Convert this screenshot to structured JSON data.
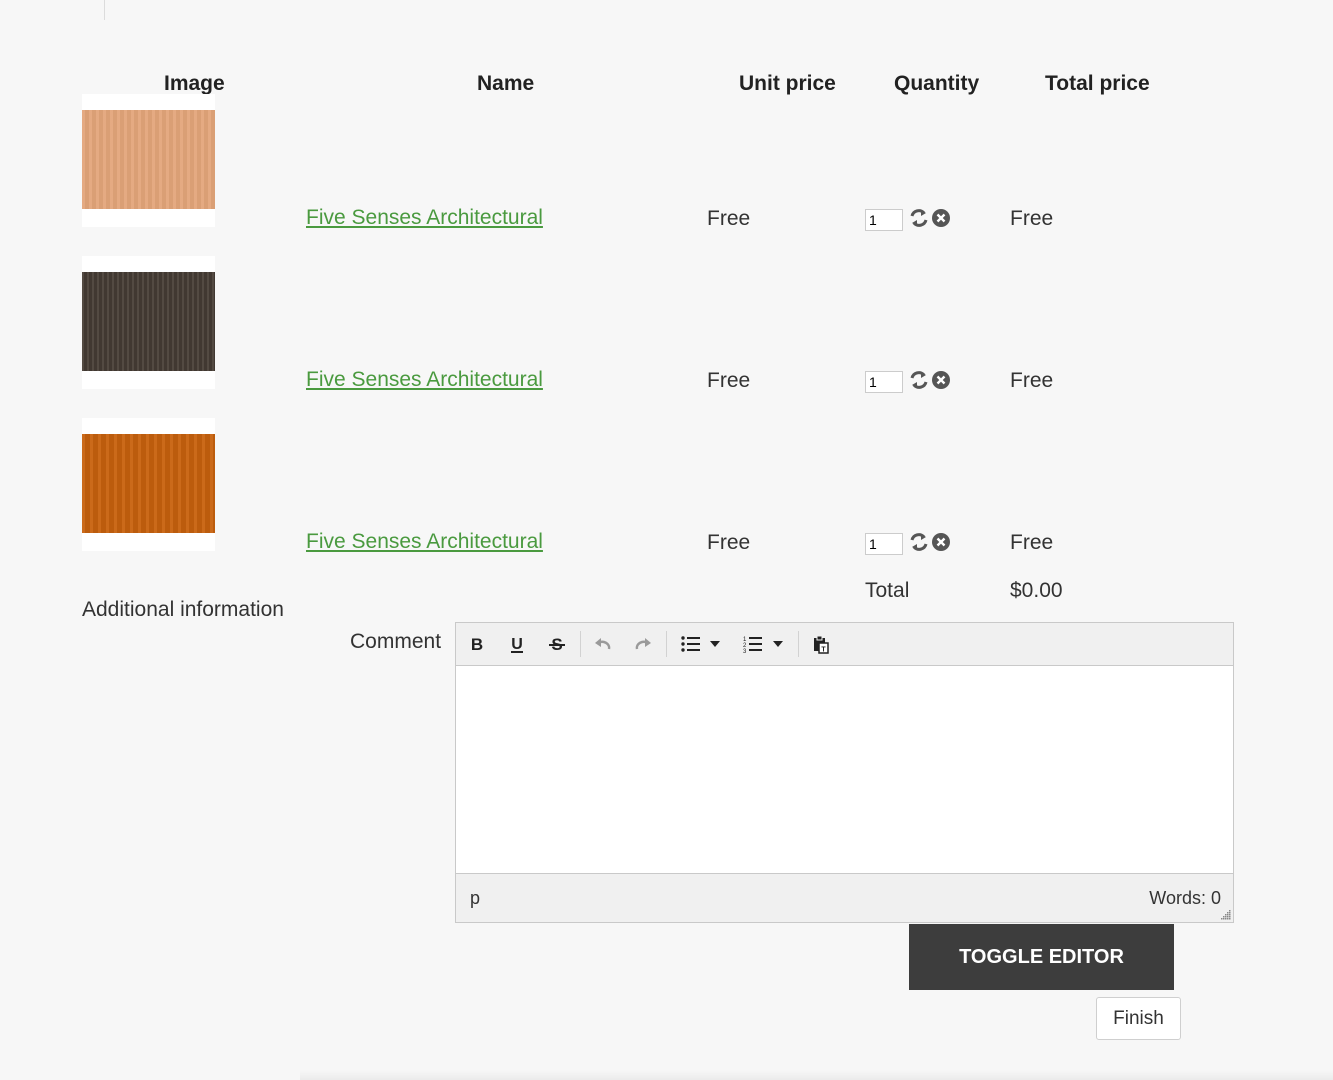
{
  "table": {
    "headers": {
      "image": "Image",
      "name": "Name",
      "unit_price": "Unit price",
      "quantity": "Quantity",
      "total_price": "Total price"
    },
    "rows": [
      {
        "name": "Five Senses Architectural",
        "unit_price": "Free",
        "quantity": "1",
        "total_price": "Free",
        "swatch_color": "#e3a57a"
      },
      {
        "name": "Five Senses Architectural",
        "unit_price": "Free",
        "quantity": "1",
        "total_price": "Free",
        "swatch_color": "#4a4038"
      },
      {
        "name": "Five Senses Architectural",
        "unit_price": "Free",
        "quantity": "1",
        "total_price": "Free",
        "swatch_color": "#c8620e"
      }
    ],
    "total_label": "Total",
    "total_value": "$0.00"
  },
  "form": {
    "section_label": "Additional information",
    "comment_label": "Comment"
  },
  "editor": {
    "toolbar": [
      "bold-icon",
      "underline-icon",
      "strikethrough-icon",
      "undo-icon",
      "redo-icon",
      "bullet-list-icon",
      "numbered-list-icon",
      "paste-text-icon"
    ],
    "path": "p",
    "word_count": "Words: 0"
  },
  "buttons": {
    "toggle_editor": "TOGGLE EDITOR",
    "finish": "Finish"
  },
  "colors": {
    "link": "#4a9a3f",
    "dark_button": "#3d3d3d",
    "background": "#f7f7f7"
  }
}
